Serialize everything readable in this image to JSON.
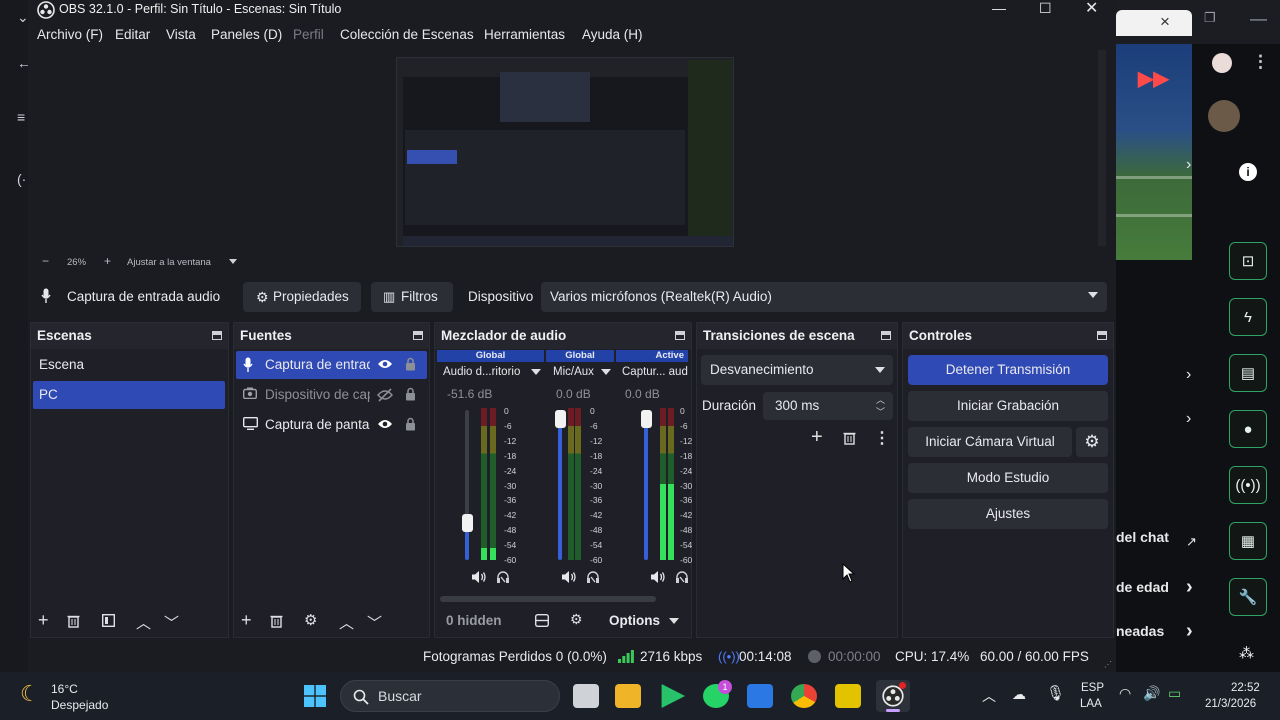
{
  "window": {
    "title": "OBS 32.1.0 - Perfil: Sin Título - Escenas: Sin Título"
  },
  "menu": [
    "Archivo (F)",
    "Editar",
    "Vista",
    "Paneles (D)",
    "Perfil",
    "Colección de Escenas",
    "Herramientas",
    "Ayuda (H)"
  ],
  "preview": {
    "zoom": "26%",
    "fit_label": "Ajustar a la ventana"
  },
  "source_toolbar": {
    "source_name": "Captura de entrada audio",
    "properties": "Propiedades",
    "filters": "Filtros",
    "device_label": "Dispositivo",
    "device_value": "Varios micrófonos (Realtek(R) Audio)"
  },
  "scenes": {
    "title": "Escenas",
    "items": [
      {
        "label": "Escena",
        "selected": false
      },
      {
        "label": "PC",
        "selected": true
      }
    ]
  },
  "sources": {
    "title": "Fuentes",
    "items": [
      {
        "label": "Captura de entrada audio",
        "icon": "microphone-icon",
        "visible": true,
        "selected": true
      },
      {
        "label": "Dispositivo de captura de video",
        "icon": "camera-icon",
        "visible": false,
        "selected": false
      },
      {
        "label": "Captura de pantalla",
        "icon": "monitor-icon",
        "visible": true,
        "selected": false
      }
    ]
  },
  "mixer": {
    "title": "Mezclador de audio",
    "scale": [
      "0",
      "-6",
      "-12",
      "-18",
      "-24",
      "-30",
      "-36",
      "-42",
      "-48",
      "-54",
      "-60"
    ],
    "channels": [
      {
        "header": "Global",
        "name": "Audio d...ritorio",
        "db": "-51.6 dB",
        "volume": 0.25,
        "level": 0.08
      },
      {
        "header": "Global",
        "name": "Mic/Aux",
        "db": "0.0 dB",
        "volume": 1.0,
        "level": 0.0
      },
      {
        "header": "Active",
        "name": "Captur... audi",
        "db": "0.0 dB",
        "volume": 1.0,
        "level": 0.5
      }
    ],
    "hidden": "0 hidden",
    "options": "Options"
  },
  "transitions": {
    "title": "Transiciones de escena",
    "selected": "Desvanecimiento",
    "duration_label": "Duración",
    "duration_value": "300 ms"
  },
  "controls": {
    "title": "Controles",
    "stop_stream": "Detener Transmisión",
    "start_recording": "Iniciar Grabación",
    "start_virtual_cam": "Iniciar Cámara Virtual",
    "studio_mode": "Modo Estudio",
    "settings": "Ajustes"
  },
  "status": {
    "dropped_frames": "Fotogramas Perdidos 0 (0.0%)",
    "bitrate": "2716 kbps",
    "stream_time": "00:14:08",
    "record_time": "00:00:00",
    "cpu": "CPU: 17.4%",
    "fps": "60.00 / 60.00 FPS"
  },
  "background_page": {
    "chat_popout": "del chat",
    "age": "de edad",
    "other": "neadas"
  },
  "taskbar": {
    "weather_temp": "16°C",
    "weather_desc": "Despejado",
    "search_placeholder": "Buscar",
    "lang_top": "ESP",
    "lang_bottom": "LAA",
    "time": "22:52",
    "date": "21/3/2026",
    "whatsapp_badge": "1"
  },
  "colors": {
    "accent": "#2f49b5",
    "panel": "#1f2027",
    "window": "#1b1c22"
  }
}
